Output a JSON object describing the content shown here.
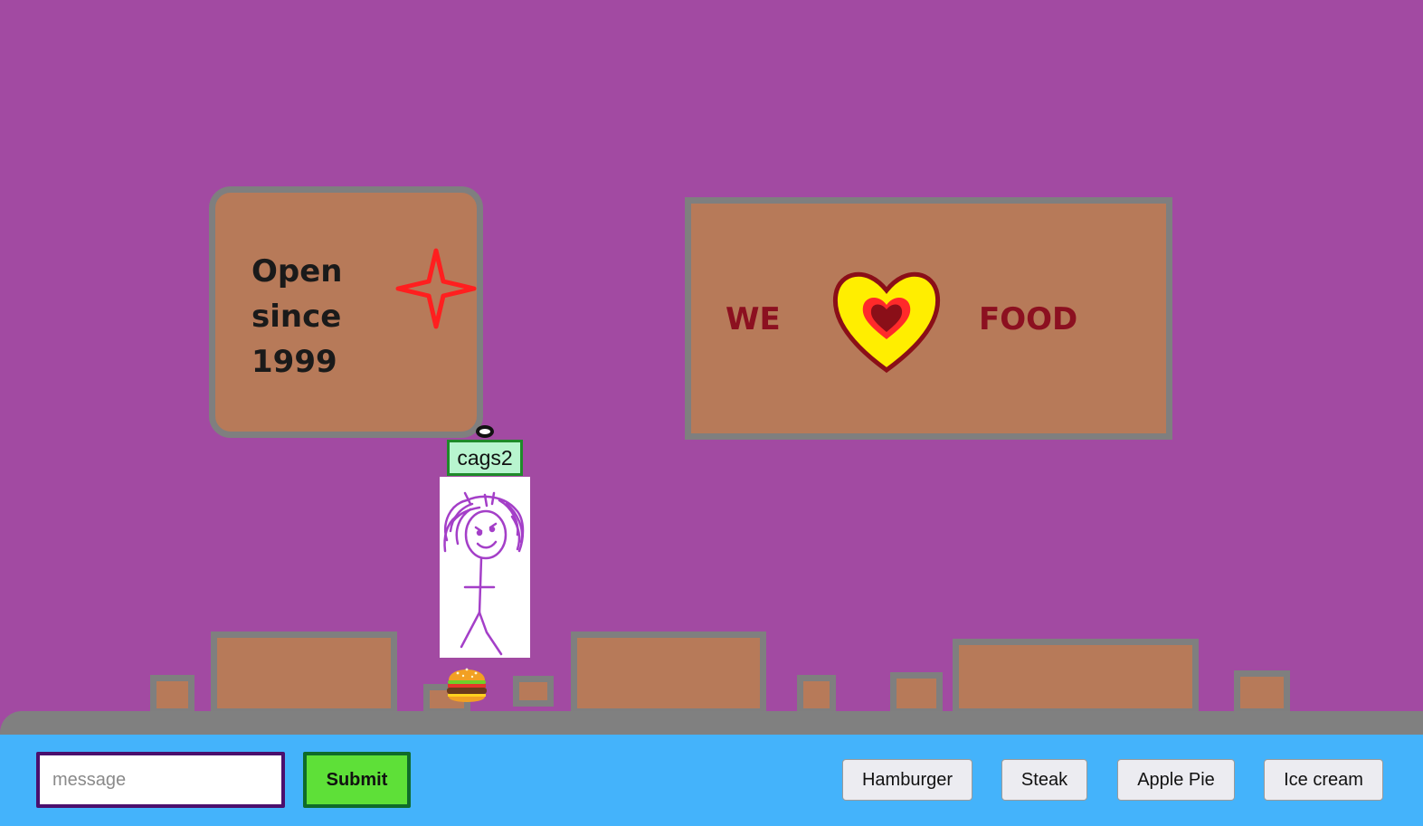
{
  "signs": {
    "open_sign": {
      "text": "Open\nsince\n1999",
      "star_color": "#ff1f1f"
    },
    "love_sign": {
      "left_word": "WE",
      "right_word": "FOOD",
      "heart_icon": "heart-icon"
    }
  },
  "player": {
    "username": "cags2",
    "avatar_icon": "stick-figure-avatar",
    "held_item": "hamburger-icon"
  },
  "chat": {
    "placeholder": "message",
    "value": "",
    "submit_label": "Submit"
  },
  "food_buttons": [
    "Hamburger",
    "Steak",
    "Apple Pie",
    "Ice cream"
  ],
  "colors": {
    "background": "#a24aa2",
    "sign_fill": "#b77a59",
    "sign_border": "#7f7f7f",
    "bottom_bar": "#44b3fb",
    "submit_green": "#5ee038",
    "tag_fill": "#b8f5cf"
  }
}
